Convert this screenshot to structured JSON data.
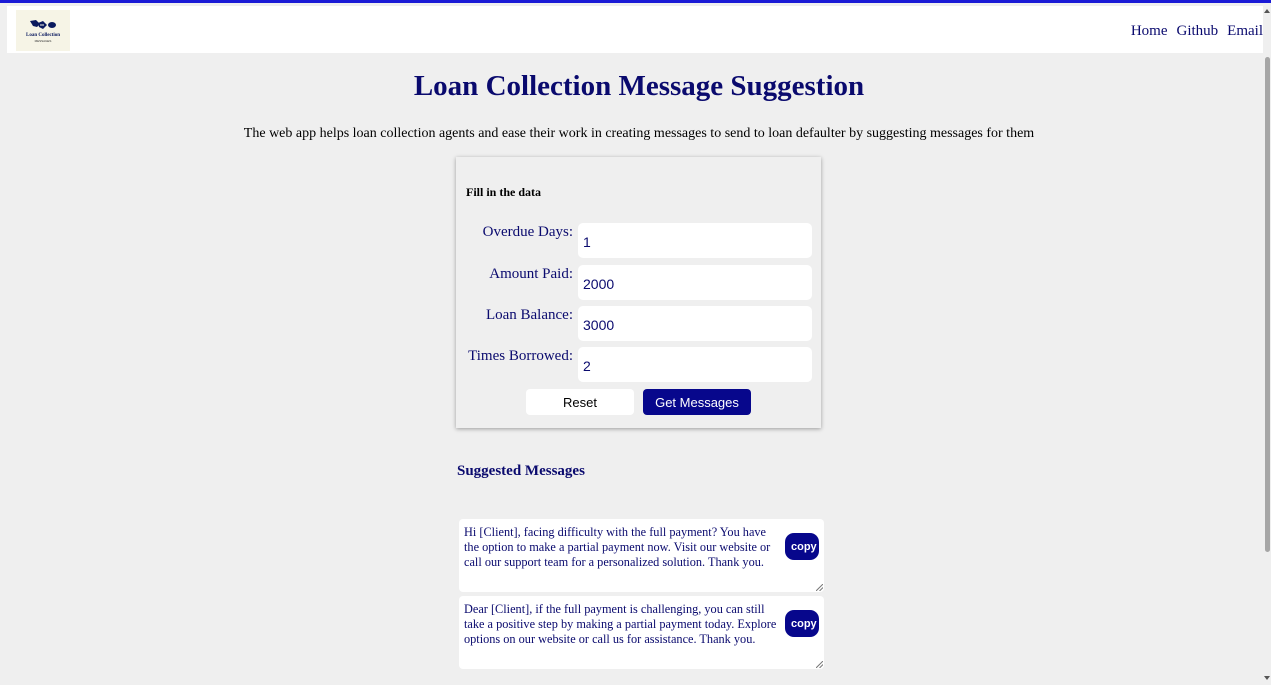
{
  "nav": {
    "logo_text": "Loan Collection",
    "logo_subtext": "MESSAGES",
    "links": [
      "Home",
      "Github",
      "Email"
    ]
  },
  "header": {
    "title": "Loan Collection Message Suggestion",
    "description": "The web app helps loan collection agents and ease their work in creating messages to send to loan defaulter by suggesting messages for them"
  },
  "form": {
    "heading": "Fill in the data",
    "fields": [
      {
        "label": "Overdue Days:",
        "value": "1"
      },
      {
        "label": "Amount Paid:",
        "value": "2000"
      },
      {
        "label": "Loan Balance:",
        "value": "3000"
      },
      {
        "label": "Times Borrowed:",
        "value": "2"
      }
    ],
    "reset_label": "Reset",
    "submit_label": "Get Messages"
  },
  "suggestions": {
    "heading": "Suggested Messages",
    "copy_label": "copy",
    "messages": [
      "Hi [Client], facing difficulty with the full payment? You have the option to make a partial payment now. Visit our website or call our support team for a personalized solution. Thank you.",
      "Dear [Client], if the full payment is challenging, you can still take a positive step by making a partial payment today. Explore options on our website or call us for assistance. Thank you."
    ]
  },
  "colors": {
    "accent": "#07078c",
    "text_navy": "#0a0a6e",
    "top_strip": "#1a1ad6",
    "background": "#efefef"
  }
}
